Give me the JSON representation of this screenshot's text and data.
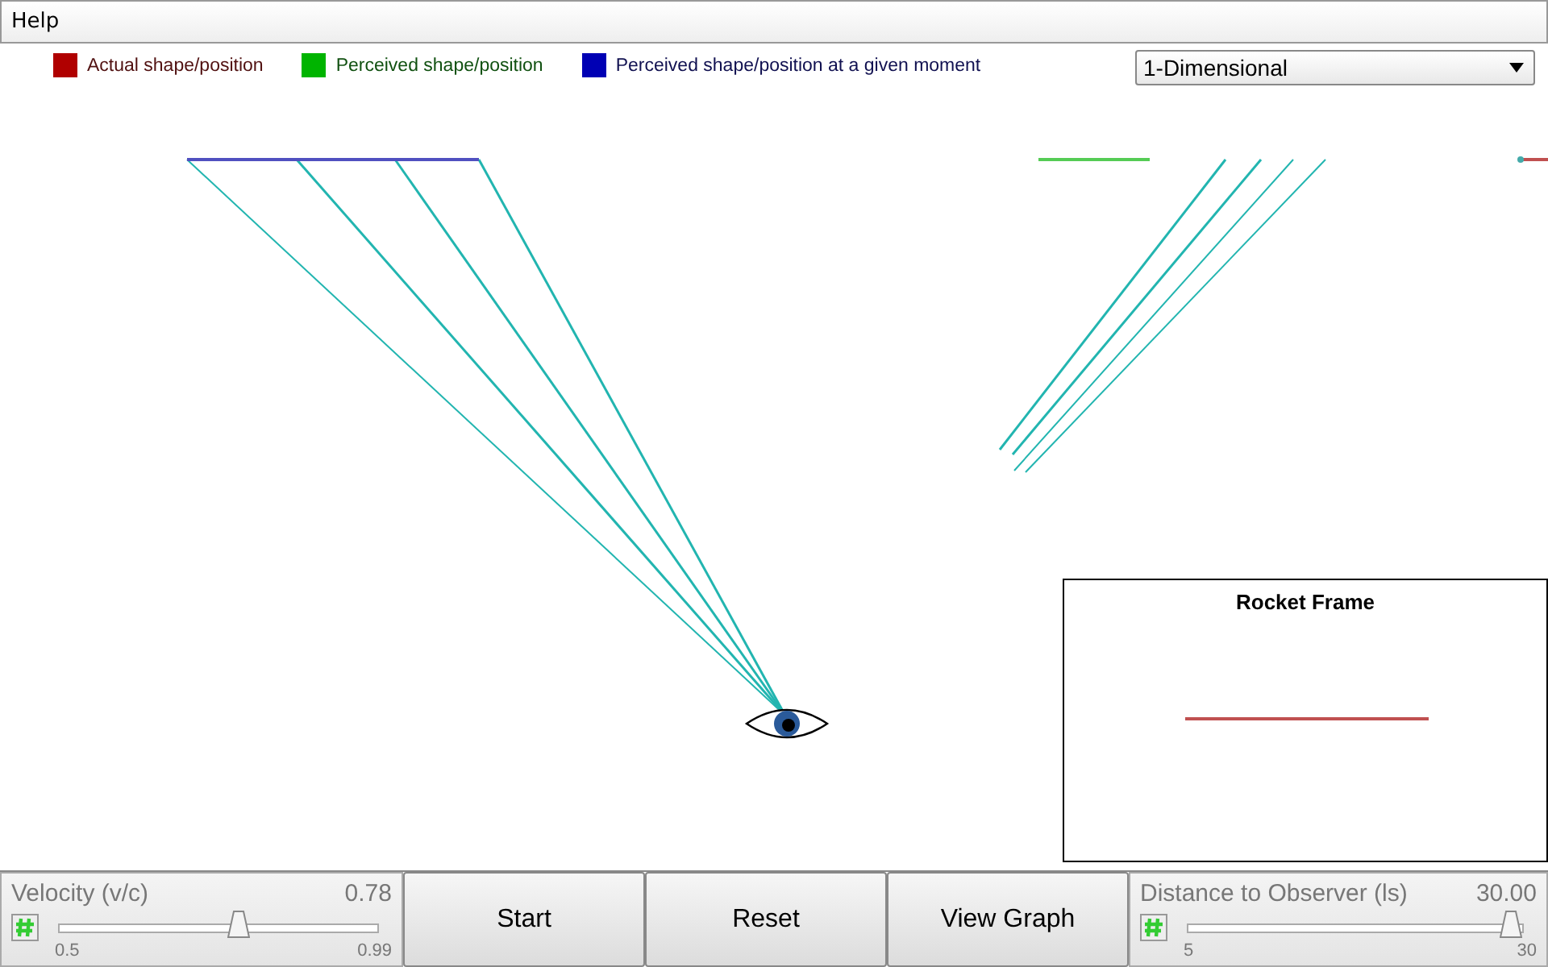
{
  "menu": [
    "Help"
  ],
  "legend": [
    {
      "label": "Actual shape/position",
      "color": "#b00000"
    },
    {
      "label": "Perceived shape/position",
      "color": "#00b400"
    },
    {
      "label": "Perceived shape/position at a given moment",
      "color": "#0000b4"
    }
  ],
  "mode_select": {
    "value": "1-Dimensional"
  },
  "rocket_frame": {
    "title": "Rocket Frame"
  },
  "velocity": {
    "label": "Velocity (v/c)",
    "reading": "0.78",
    "level": 0.57,
    "min": "0.5",
    "max": "0.99"
  },
  "buttons": [
    "Start",
    "Reset",
    "View Graph"
  ],
  "distance": {
    "label": "Distance to Observer (ls)",
    "reading": "30.00",
    "level": 1,
    "min": "5",
    "max": "30"
  }
}
